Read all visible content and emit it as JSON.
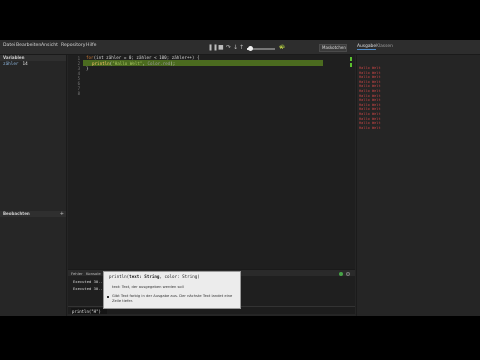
{
  "menu": [
    "Datei",
    "Bearbeiten",
    "Ansicht",
    "Repository",
    "Hilfe"
  ],
  "toolbar": {
    "icons": [
      "play-pause-icon",
      "stop-icon",
      "step-over-icon",
      "step-into-icon",
      "step-out-icon",
      "speed-icon"
    ],
    "glyphs": [
      "❚❚",
      "■",
      "↷",
      "↓",
      "↑",
      "🐢"
    ],
    "speed_fraction": 0.1,
    "mode_label": "Maskotchen Tingel"
  },
  "right_tabs": {
    "output": "Ausgabe",
    "classes": "Klassen"
  },
  "variables": {
    "header": "Variablen",
    "name": "zähler",
    "value": "14"
  },
  "notes": {
    "header": "Beobachten",
    "add": "+"
  },
  "editor": {
    "line_numbers": [
      "1",
      "2",
      "3",
      "4",
      "5",
      "6",
      "7",
      "8"
    ],
    "line1": {
      "kw": "for",
      "rest": "(int zähler = 0; zähler < 100; zähler++)",
      "brace": " {"
    },
    "line2": {
      "fn": "println",
      "open": "(",
      "str": "\"Hallo Welt\"",
      "mid": ", ",
      "arg": "Color.red",
      "close": ");"
    },
    "line3": "}"
  },
  "output_lines": [
    "Hallo Welt",
    "Hallo Welt",
    "Hallo Welt",
    "Hallo Welt",
    "Hallo Welt",
    "Hallo Welt",
    "Hallo Welt",
    "Hallo Welt",
    "Hallo Welt",
    "Hallo Welt",
    "Hallo Welt",
    "Hallo Welt",
    "Hallo Welt",
    "Hallo Welt"
  ],
  "output_color": "#c84444",
  "bottom_tabs": [
    "Fehler",
    "Konsole",
    "Wo"
  ],
  "console": {
    "line1": "Executed 30...",
    "line2": "Executed 30..."
  },
  "input_value": "println(\"H\")",
  "popup": {
    "sig_name": "println(",
    "sig_bold": "text: String",
    "sig_rest": ", color: String)",
    "param": "text: Text, der ausgegeben werden soll",
    "description": "Gibt Text farbig in der Ausgabe aus. Der nächste Text landet eine Zeile tiefer."
  },
  "colors": {
    "highlight_line": "#4b6b1f",
    "status_ok": "#47a447",
    "scroll_mark": "#5bbf2f"
  }
}
